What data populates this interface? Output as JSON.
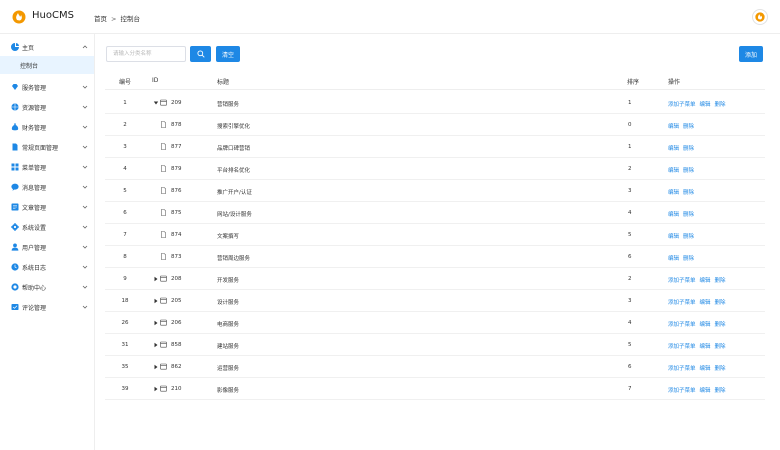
{
  "app": {
    "brand": "HuoCMS",
    "brand_color": "#f39800",
    "accent": "#1e88e5"
  },
  "breadcrumb": {
    "home": "首页",
    "separator": ">",
    "current": "控制台"
  },
  "sidebar": {
    "items": [
      {
        "label": "主页",
        "icon": "pie-chart-icon",
        "expanded": true
      },
      {
        "label": "服务管理",
        "icon": "diamond-icon"
      },
      {
        "label": "资源管理",
        "icon": "globe-icon"
      },
      {
        "label": "财务管理",
        "icon": "money-bag-icon"
      },
      {
        "label": "常规页面管理",
        "icon": "document-icon"
      },
      {
        "label": "菜单管理",
        "icon": "grid-icon"
      },
      {
        "label": "消息管理",
        "icon": "chat-icon"
      },
      {
        "label": "文章管理",
        "icon": "article-icon"
      },
      {
        "label": "系统设置",
        "icon": "gear-icon"
      },
      {
        "label": "用户管理",
        "icon": "user-icon"
      },
      {
        "label": "系统日志",
        "icon": "log-icon"
      },
      {
        "label": "帮助中心",
        "icon": "help-icon"
      },
      {
        "label": "评论管理",
        "icon": "comment-icon"
      }
    ],
    "sub_item": "控制台"
  },
  "toolbar": {
    "search_placeholder": "请输入分类名称",
    "clear_label": "清空",
    "add_label": "添加"
  },
  "table": {
    "headers": {
      "num": "编号",
      "id": "ID",
      "title": "标题",
      "sort": "排序",
      "actions": "操作"
    },
    "action_labels": {
      "add_sub": "添加子菜单",
      "edit": "编辑",
      "delete": "删除"
    },
    "rows": [
      {
        "num": "1",
        "id": "209",
        "title": "营销服务",
        "sort": "1",
        "level": 0,
        "expanded": true,
        "has_sub_action": true
      },
      {
        "num": "2",
        "id": "878",
        "title": "搜索引擎优化",
        "sort": "0",
        "level": 1
      },
      {
        "num": "3",
        "id": "877",
        "title": "品牌口碑营销",
        "sort": "1",
        "level": 1
      },
      {
        "num": "4",
        "id": "879",
        "title": "平台排名优化",
        "sort": "2",
        "level": 1
      },
      {
        "num": "5",
        "id": "876",
        "title": "推广开户/认证",
        "sort": "3",
        "level": 1
      },
      {
        "num": "6",
        "id": "875",
        "title": "网站/设计服务",
        "sort": "4",
        "level": 1
      },
      {
        "num": "7",
        "id": "874",
        "title": "文案撰写",
        "sort": "5",
        "level": 1
      },
      {
        "num": "8",
        "id": "873",
        "title": "营销周边服务",
        "sort": "6",
        "level": 1
      },
      {
        "num": "9",
        "id": "208",
        "title": "开发服务",
        "sort": "2",
        "level": 0,
        "expanded": false,
        "has_sub_action": true
      },
      {
        "num": "18",
        "id": "205",
        "title": "设计服务",
        "sort": "3",
        "level": 0,
        "expanded": false,
        "has_sub_action": true
      },
      {
        "num": "26",
        "id": "206",
        "title": "电商服务",
        "sort": "4",
        "level": 0,
        "expanded": false,
        "has_sub_action": true
      },
      {
        "num": "31",
        "id": "858",
        "title": "建站服务",
        "sort": "5",
        "level": 0,
        "expanded": false,
        "has_sub_action": true
      },
      {
        "num": "35",
        "id": "862",
        "title": "运营服务",
        "sort": "6",
        "level": 0,
        "expanded": false,
        "has_sub_action": true
      },
      {
        "num": "39",
        "id": "210",
        "title": "影像服务",
        "sort": "7",
        "level": 0,
        "expanded": false,
        "has_sub_action": true
      }
    ]
  }
}
